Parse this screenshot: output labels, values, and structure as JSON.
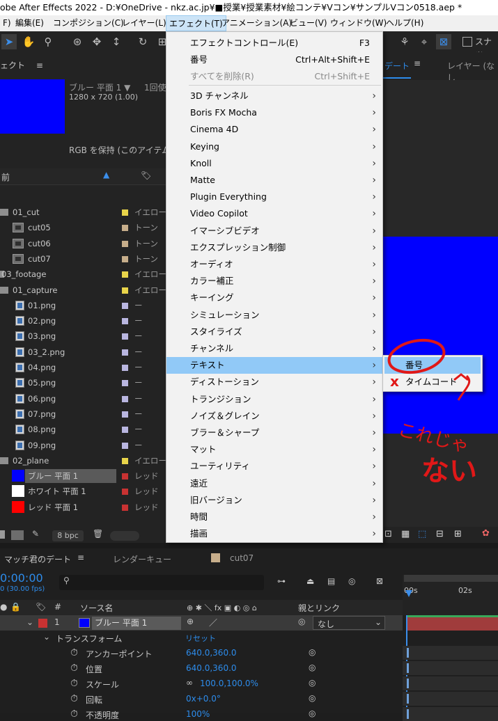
{
  "title_bar": "obe After Effects 2022 - D:¥OneDrive - nkz.ac.jp¥■授業¥授業素材¥絵コンテ¥Vコン¥サンプルVコン0518.aep *",
  "menubar": {
    "items": [
      "F)",
      "編集(E)",
      "コンポジション(C)",
      "レイヤー(L)",
      "エフェクト(T)",
      "アニメーション(A)",
      "ビュー(V)",
      "ウィンドウ(W)",
      "ヘルプ(H)"
    ]
  },
  "toolbar": {
    "snap_label": "スナッ"
  },
  "project_panel": {
    "tab_label": "ェクト",
    "footage_name": "ブルー 平面 1 ▼",
    "footage_used": "1回使",
    "footage_size": "1280 x 720 (1.00)",
    "footage_note": "RGB を保持 (このアイテム",
    "col_name": "前"
  },
  "project_items": [
    {
      "name": "01_cut",
      "kind": "folder",
      "label": "イエロー",
      "color": "#e8d44a",
      "indent": 1
    },
    {
      "name": "cut05",
      "kind": "comp",
      "label": "トーン",
      "color": "#c7ae8b",
      "indent": 2
    },
    {
      "name": "cut06",
      "kind": "comp",
      "label": "トーン",
      "color": "#c7ae8b",
      "indent": 2
    },
    {
      "name": "cut07",
      "kind": "comp",
      "label": "トーン",
      "color": "#c7ae8b",
      "indent": 2
    },
    {
      "name": "03_footage",
      "kind": "folder",
      "label": "イエロー",
      "color": "#e8d44a",
      "indent": 0
    },
    {
      "name": "01_capture",
      "kind": "folder",
      "label": "イエロー",
      "color": "#e8d44a",
      "indent": 1
    },
    {
      "name": "01.png",
      "kind": "file",
      "label": "ー",
      "color": "#b9b6e0",
      "indent": 2
    },
    {
      "name": "02.png",
      "kind": "file",
      "label": "ー",
      "color": "#b9b6e0",
      "indent": 2
    },
    {
      "name": "03.png",
      "kind": "file",
      "label": "ー",
      "color": "#b9b6e0",
      "indent": 2
    },
    {
      "name": "03_2.png",
      "kind": "file",
      "label": "ー",
      "color": "#b9b6e0",
      "indent": 2
    },
    {
      "name": "04.png",
      "kind": "file",
      "label": "ー",
      "color": "#b9b6e0",
      "indent": 2
    },
    {
      "name": "05.png",
      "kind": "file",
      "label": "ー",
      "color": "#b9b6e0",
      "indent": 2
    },
    {
      "name": "06.png",
      "kind": "file",
      "label": "ー",
      "color": "#b9b6e0",
      "indent": 2
    },
    {
      "name": "07.png",
      "kind": "file",
      "label": "ー",
      "color": "#b9b6e0",
      "indent": 2
    },
    {
      "name": "08.png",
      "kind": "file",
      "label": "ー",
      "color": "#b9b6e0",
      "indent": 2
    },
    {
      "name": "09.png",
      "kind": "file",
      "label": "ー",
      "color": "#b9b6e0",
      "indent": 2
    },
    {
      "name": "02_plane",
      "kind": "folder",
      "label": "イエロー",
      "color": "#e8d44a",
      "indent": 1
    },
    {
      "name": "ブルー 平面 1",
      "kind": "solid",
      "swatch": "#0000ff",
      "label": "レッド",
      "color": "#c83232",
      "indent": 2,
      "selected": true
    },
    {
      "name": "ホワイト 平面 1",
      "kind": "solid",
      "swatch": "#ffffff",
      "label": "レッド",
      "color": "#c83232",
      "indent": 2
    },
    {
      "name": "レッド 平面 1",
      "kind": "solid",
      "swatch": "#ff0000",
      "label": "レッド",
      "color": "#c83232",
      "indent": 2
    }
  ],
  "project_footer": {
    "bpc": "8 bpc"
  },
  "effect_menu": {
    "items": [
      {
        "label": "エフェクトコントロール(E)",
        "shortcut": "F3"
      },
      {
        "label": "番号",
        "shortcut": "Ctrl+Alt+Shift+E"
      },
      {
        "label": "すべてを削除(R)",
        "shortcut": "Ctrl+Shift+E",
        "disabled": true
      },
      {
        "label": "3D チャンネル",
        "sub": true
      },
      {
        "label": "Boris FX Mocha",
        "sub": true
      },
      {
        "label": "Cinema 4D",
        "sub": true
      },
      {
        "label": "Keying",
        "sub": true
      },
      {
        "label": "Knoll",
        "sub": true
      },
      {
        "label": "Matte",
        "sub": true
      },
      {
        "label": "Plugin Everything",
        "sub": true
      },
      {
        "label": "Video Copilot",
        "sub": true
      },
      {
        "label": "イマーシブビデオ",
        "sub": true
      },
      {
        "label": "エクスプレッション制御",
        "sub": true
      },
      {
        "label": "オーディオ",
        "sub": true
      },
      {
        "label": "カラー補正",
        "sub": true
      },
      {
        "label": "キーイング",
        "sub": true
      },
      {
        "label": "シミュレーション",
        "sub": true
      },
      {
        "label": "スタイライズ",
        "sub": true
      },
      {
        "label": "チャンネル",
        "sub": true
      },
      {
        "label": "テキスト",
        "sub": true,
        "hover": true
      },
      {
        "label": "ディストーション",
        "sub": true
      },
      {
        "label": "トランジション",
        "sub": true
      },
      {
        "label": "ノイズ＆グレイン",
        "sub": true
      },
      {
        "label": "ブラー＆シャープ",
        "sub": true
      },
      {
        "label": "マット",
        "sub": true
      },
      {
        "label": "ユーティリティ",
        "sub": true
      },
      {
        "label": "遠近",
        "sub": true
      },
      {
        "label": "旧バージョン",
        "sub": true
      },
      {
        "label": "時間",
        "sub": true
      },
      {
        "label": "描画",
        "sub": true
      }
    ]
  },
  "text_submenu": {
    "items": [
      "番号",
      "タイムコード"
    ]
  },
  "viewer": {
    "tab_label": "デート",
    "layer_tab": "レイヤー (なし"
  },
  "timeline": {
    "tab_comp": "マッチ君のデート",
    "tab_render": "レンダーキュー",
    "tab_cut": "cut07",
    "timecode": "0:00:00",
    "fps": "0 (30.00 fps)",
    "col_hash": "#",
    "col_source": "ソース名",
    "col_parent": "親とリンク",
    "ruler_0": "00s",
    "ruler_2": "02s",
    "layer_num": "1",
    "layer_name": "ブルー 平面 1",
    "parent_value": "なし",
    "transform_label": "トランスフォーム",
    "reset_label": "リセット",
    "props": [
      {
        "name": "アンカーポイント",
        "value": "640.0,360.0"
      },
      {
        "name": "位置",
        "value": "640.0,360.0"
      },
      {
        "name": "スケール",
        "value": "100.0,100.0%"
      },
      {
        "name": "回転",
        "value": "0x+0.0°"
      },
      {
        "name": "不透明度",
        "value": "100%"
      }
    ]
  },
  "annotations": {
    "cross": "x",
    "handwriting_line1": "これじゃ",
    "handwriting_line2": "ない"
  },
  "colors": {
    "accent_blue": "#2d8ceb",
    "menu_hover": "#91c9f7",
    "annotation_red": "#e01818",
    "solid_blue": "#0000ff"
  }
}
